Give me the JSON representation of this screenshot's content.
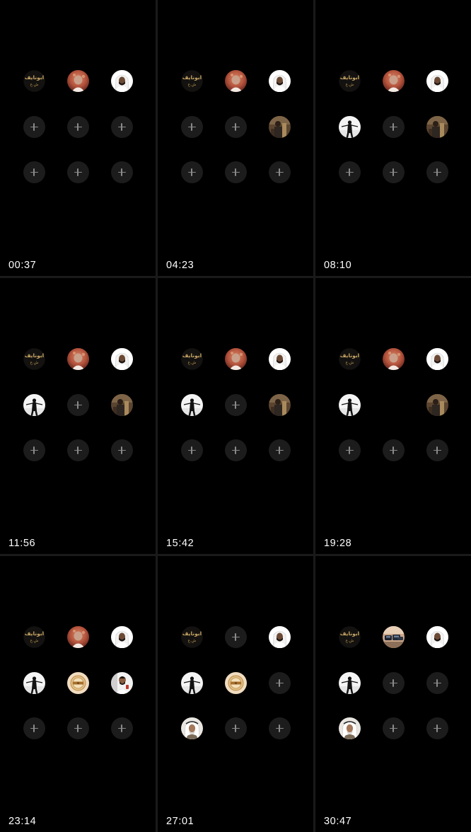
{
  "panels": [
    {
      "timestamp": "00:37",
      "slots": [
        "logo-abu-nayef",
        "avatar-red-portrait",
        "avatar-white-ghutra",
        "empty",
        "empty",
        "empty",
        "empty",
        "empty",
        "empty"
      ]
    },
    {
      "timestamp": "04:23",
      "slots": [
        "logo-abu-nayef",
        "avatar-red-portrait",
        "avatar-white-ghutra",
        "empty",
        "empty",
        "avatar-brown-photo",
        "empty",
        "empty",
        "empty"
      ]
    },
    {
      "timestamp": "08:10",
      "slots": [
        "logo-abu-nayef",
        "avatar-red-portrait",
        "avatar-white-ghutra",
        "avatar-silhouette-white",
        "empty",
        "avatar-brown-photo",
        "empty",
        "empty",
        "empty"
      ]
    },
    {
      "timestamp": "11:56",
      "slots": [
        "logo-abu-nayef",
        "avatar-red-portrait",
        "avatar-white-ghutra",
        "avatar-silhouette-white",
        "empty",
        "avatar-brown-photo",
        "empty",
        "empty",
        "empty"
      ]
    },
    {
      "timestamp": "15:42",
      "slots": [
        "logo-abu-nayef",
        "avatar-red-portrait",
        "avatar-white-ghutra",
        "avatar-silhouette-white",
        "empty",
        "avatar-brown-photo",
        "empty",
        "empty",
        "empty"
      ]
    },
    {
      "timestamp": "19:28",
      "slots": [
        "logo-abu-nayef",
        "avatar-red-portrait",
        "avatar-white-ghutra",
        "avatar-silhouette-white",
        "blank",
        "avatar-brown-photo",
        "empty",
        "empty",
        "empty"
      ]
    },
    {
      "timestamp": "23:14",
      "slots": [
        "logo-abu-nayef",
        "avatar-red-portrait",
        "avatar-white-ghutra",
        "avatar-silhouette-white",
        "avatar-gold-emblem",
        "avatar-man-speaking",
        "empty",
        "empty",
        "empty"
      ]
    },
    {
      "timestamp": "27:01",
      "slots": [
        "logo-abu-nayef",
        "empty",
        "avatar-white-ghutra",
        "avatar-silhouette-white",
        "avatar-gold-emblem",
        "empty",
        "avatar-elder-ghutra",
        "empty",
        "empty"
      ]
    },
    {
      "timestamp": "30:47",
      "slots": [
        "logo-abu-nayef",
        "avatar-cars-photo",
        "avatar-white-ghutra",
        "avatar-silhouette-white",
        "empty",
        "empty",
        "avatar-elder-ghutra",
        "empty",
        "empty"
      ]
    }
  ],
  "logo_text": {
    "line1": "ابونايف",
    "line2": "ش.ع"
  },
  "colors": {
    "background": "#000000",
    "divider": "#1a1a1a",
    "empty_slot": "#1c1c1c",
    "plus": "#8a8a8a",
    "timestamp": "#ffffff"
  }
}
